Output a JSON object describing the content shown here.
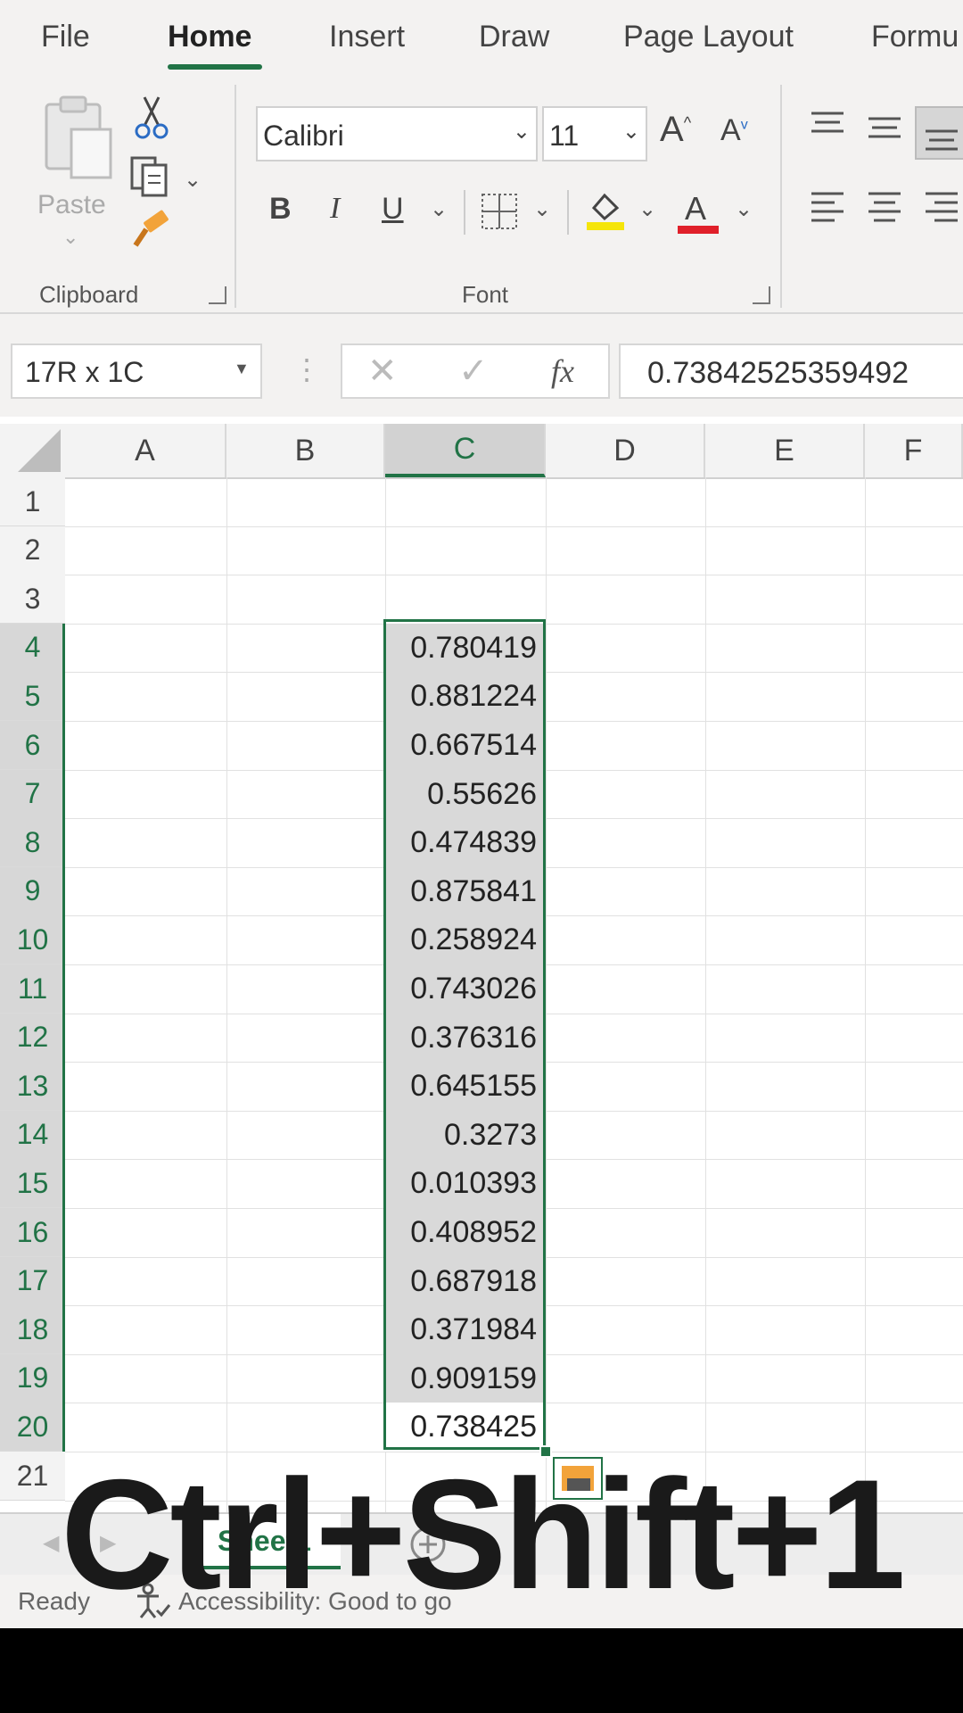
{
  "ribbon_tabs": [
    "File",
    "Home",
    "Insert",
    "Draw",
    "Page Layout",
    "Formu"
  ],
  "clipboard": {
    "paste_label": "Paste",
    "group_label": "Clipboard"
  },
  "font": {
    "name": "Calibri",
    "size": "11",
    "group_label": "Font"
  },
  "name_box": "17R x 1C",
  "formula_value": "0.73842525359492",
  "fx_label": "fx",
  "columns": [
    "A",
    "B",
    "C",
    "D",
    "E",
    "F"
  ],
  "rows": [
    "1",
    "2",
    "3",
    "4",
    "5",
    "6",
    "7",
    "8",
    "9",
    "10",
    "11",
    "12",
    "13",
    "14",
    "15",
    "16",
    "17",
    "18",
    "19",
    "20",
    "21"
  ],
  "column_c_values": [
    "0.780419",
    "0.881224",
    "0.667514",
    "0.55626",
    "0.474839",
    "0.875841",
    "0.258924",
    "0.743026",
    "0.376316",
    "0.645155",
    "0.3273",
    "0.010393",
    "0.408952",
    "0.687918",
    "0.371984",
    "0.909159",
    "0.738425"
  ],
  "sheet_tab": "Sheet1",
  "status": {
    "ready": "Ready",
    "accessibility": "Accessibility: Good to go"
  },
  "caption": "Ctrl+Shift+1",
  "colors": {
    "accent": "#217346",
    "selection_fill": "#d9d9d9"
  }
}
